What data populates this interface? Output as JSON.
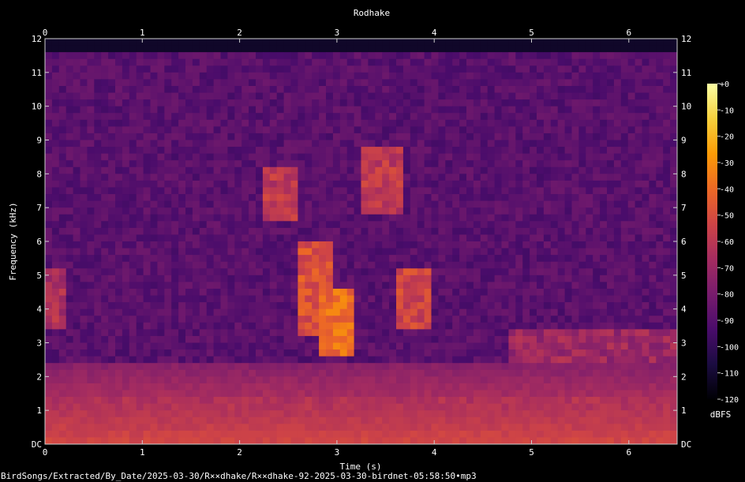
{
  "chart_data": {
    "type": "heatmap",
    "title": "Rodhake",
    "xlabel": "Time (s)",
    "ylabel": "Frequency (kHz)",
    "xlim": [
      0,
      6.5
    ],
    "ylim": [
      0,
      12
    ],
    "x_ticks": [
      "0",
      "1",
      "2",
      "3",
      "4",
      "5",
      "6"
    ],
    "y_ticks": [
      "DC",
      "1",
      "2",
      "3",
      "4",
      "5",
      "6",
      "7",
      "8",
      "9",
      "10",
      "11",
      "12"
    ],
    "colorbar": {
      "unit": "dBFS",
      "range": [
        -120,
        0
      ],
      "ticks": [
        "+0",
        "-10",
        "-20",
        "-30",
        "-40",
        "-50",
        "-60",
        "-70",
        "-80",
        "-90",
        "-100",
        "-110",
        "-120"
      ]
    },
    "footer": "BirdSongs/Extracted/By_Date/2025-03-30/R××dhake/R××dhake-92-2025-03-30-birdnet-05:58:50•mp3",
    "colormap": [
      "#000004",
      "#1b0c41",
      "#4a0c6b",
      "#781c6d",
      "#a52c60",
      "#cf4446",
      "#ed6925",
      "#fb9b06",
      "#f7d13d",
      "#fcffa4"
    ],
    "features": [
      {
        "t": [
          0.0,
          0.25
        ],
        "f": [
          3.5,
          5.2
        ],
        "level": -55
      },
      {
        "t": [
          2.25,
          2.6
        ],
        "f": [
          6.6,
          8.2
        ],
        "level": -50
      },
      {
        "t": [
          2.6,
          2.95
        ],
        "f": [
          3.2,
          6.0
        ],
        "level": -40
      },
      {
        "t": [
          2.85,
          3.2
        ],
        "f": [
          2.6,
          4.5
        ],
        "level": -30
      },
      {
        "t": [
          3.25,
          3.7
        ],
        "f": [
          6.8,
          8.8
        ],
        "level": -50
      },
      {
        "t": [
          3.6,
          3.95
        ],
        "f": [
          3.5,
          5.2
        ],
        "level": -45
      },
      {
        "t": [
          4.8,
          6.5
        ],
        "f": [
          2.4,
          3.4
        ],
        "level": -60
      },
      {
        "t": [
          0.0,
          6.5
        ],
        "f": [
          0.0,
          1.4
        ],
        "level": -58
      }
    ]
  }
}
